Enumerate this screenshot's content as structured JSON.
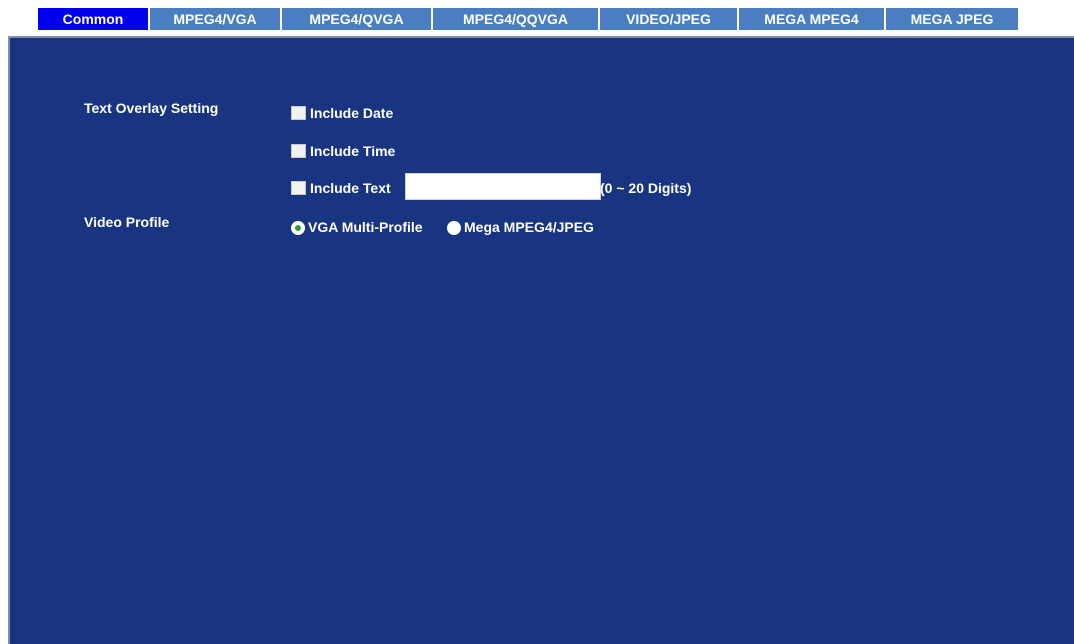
{
  "tabs": [
    {
      "label": "Common",
      "active": true
    },
    {
      "label": "MPEG4/VGA",
      "active": false
    },
    {
      "label": "MPEG4/QVGA",
      "active": false
    },
    {
      "label": "MPEG4/QQVGA",
      "active": false
    },
    {
      "label": "VIDEO/JPEG",
      "active": false
    },
    {
      "label": "MEGA MPEG4",
      "active": false
    },
    {
      "label": "MEGA JPEG",
      "active": false
    }
  ],
  "text_overlay": {
    "label": "Text Overlay Setting",
    "include_date": {
      "label": "Include Date",
      "checked": false
    },
    "include_time": {
      "label": "Include Time",
      "checked": false
    },
    "include_text": {
      "label": "Include Text",
      "checked": false,
      "value": "",
      "hint": "(0 ~ 20 Digits)"
    }
  },
  "video_profile": {
    "label": "Video Profile",
    "options": [
      {
        "label": "VGA Multi-Profile",
        "selected": true
      },
      {
        "label": "Mega MPEG4/JPEG",
        "selected": false
      }
    ]
  },
  "colors": {
    "panel_bg": "#193480",
    "tab_bg": "#4a7ec0",
    "tab_active_bg": "#0000ee",
    "radio_selected": "#2e9b2e"
  }
}
